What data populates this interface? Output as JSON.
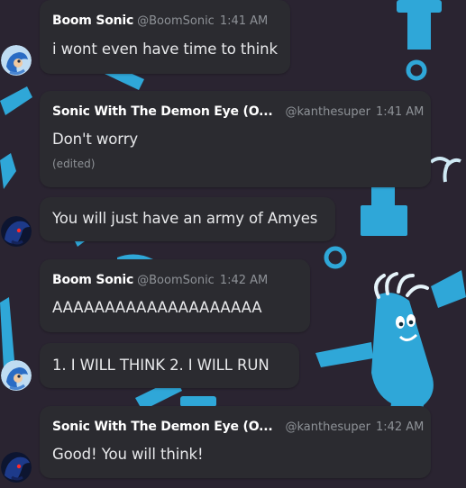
{
  "messages": [
    {
      "author": "Boom Sonic",
      "handle": "@BoomSonic",
      "time": "1:41 AM",
      "text": "i wont even have time to think"
    },
    {
      "author": "Sonic With The Demon Eye (O...",
      "handle": "@kanthesuper",
      "time": "1:41 AM",
      "text": "Don't worry",
      "edited": "(edited)"
    },
    {
      "text": "You will just have an army of Amyes"
    },
    {
      "author": "Boom Sonic",
      "handle": "@BoomSonic",
      "time": "1:42 AM",
      "text": "AAAAAAAAAAAAAAAAAAAA"
    },
    {
      "text": "1. I WILL THINK 2. I WILL RUN"
    },
    {
      "author": "Sonic With The Demon Eye (O...",
      "handle": "@kanthesuper",
      "time": "1:42 AM",
      "text": "Good! You will think!"
    }
  ],
  "avatars": [
    {
      "icon": "boom-sonic-avatar-icon"
    },
    {
      "icon": "demon-eye-sonic-avatar-icon"
    },
    {
      "icon": "boom-sonic-avatar-icon"
    },
    {
      "icon": "demon-eye-sonic-avatar-icon"
    }
  ],
  "colors": {
    "background": "#2a2431",
    "pattern": "#2fa7d8",
    "bubble": "#2b2b30",
    "muted": "#8e9297"
  }
}
